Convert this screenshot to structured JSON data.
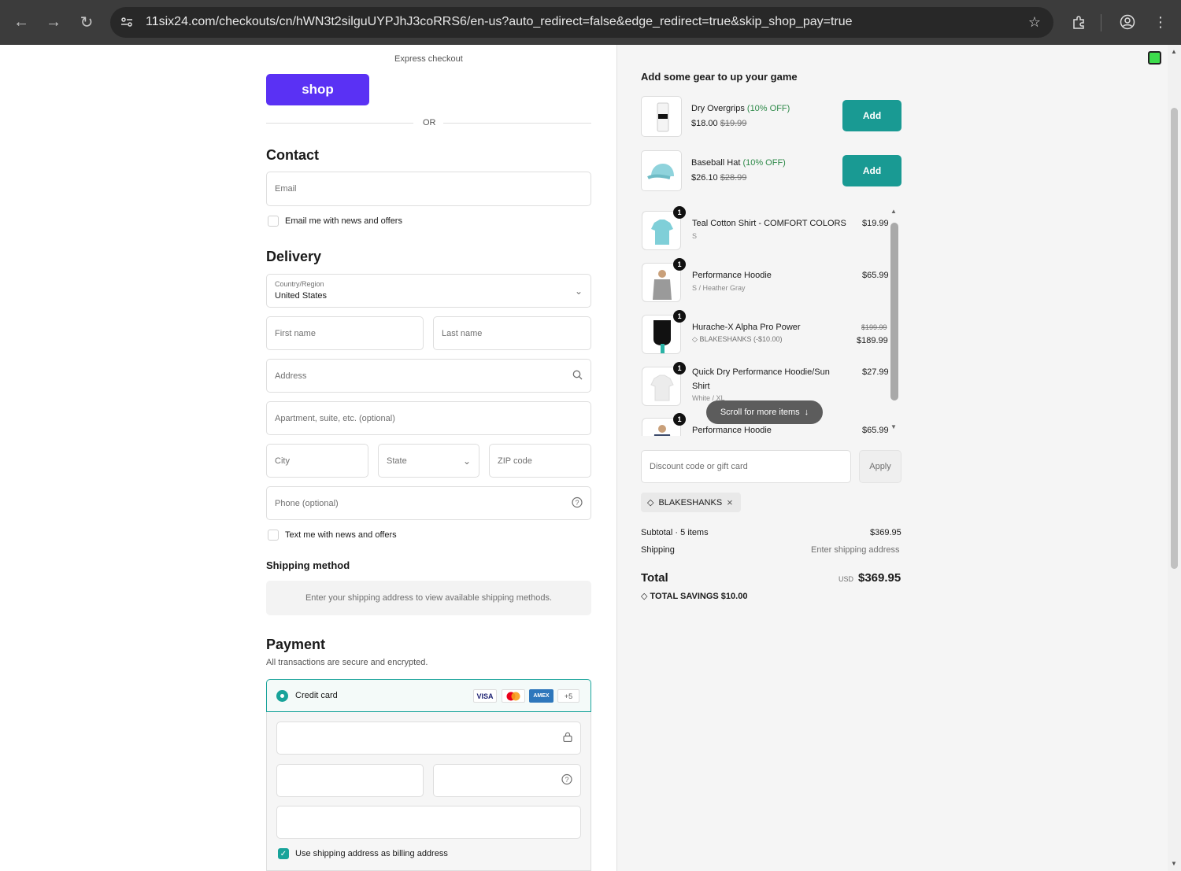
{
  "browser": {
    "url": "11six24.com/checkouts/cn/hWN3t2silguUYPJhJ3coRRS6/en-us?auto_redirect=false&edge_redirect=true&skip_shop_pay=true"
  },
  "express": {
    "label": "Express checkout",
    "shop_label": "shop",
    "or_label": "OR"
  },
  "contact": {
    "title": "Contact",
    "email_placeholder": "Email",
    "newsletter_label": "Email me with news and offers"
  },
  "delivery": {
    "title": "Delivery",
    "country_label": "Country/Region",
    "country_value": "United States",
    "first_name": "First name",
    "last_name": "Last name",
    "address": "Address",
    "apartment": "Apartment, suite, etc. (optional)",
    "city": "City",
    "state": "State",
    "zip": "ZIP code",
    "phone": "Phone (optional)",
    "sms_label": "Text me with news and offers"
  },
  "shipping_method": {
    "title": "Shipping method",
    "message": "Enter your shipping address to view available shipping methods."
  },
  "payment": {
    "title": "Payment",
    "subtitle": "All transactions are secure and encrypted.",
    "method_label": "Credit card",
    "cards": [
      "VISA",
      "MC",
      "AMEX",
      "+5"
    ],
    "billing_label": "Use shipping address as billing address"
  },
  "upsell": {
    "title": "Add some gear to up your game",
    "items": [
      {
        "name": "Dry Overgrips",
        "discount": "(10% OFF)",
        "price": "$18.00",
        "old_price": "$19.99",
        "button": "Add"
      },
      {
        "name": "Baseball Hat",
        "discount": "(10% OFF)",
        "price": "$26.10",
        "old_price": "$28.99",
        "button": "Add"
      }
    ]
  },
  "cart": {
    "items": [
      {
        "qty": "1",
        "name": "Teal Cotton Shirt - COMFORT COLORS",
        "variant": "S",
        "price": "$19.99"
      },
      {
        "qty": "1",
        "name": "Performance Hoodie",
        "variant": "S / Heather Gray",
        "price": "$65.99"
      },
      {
        "qty": "1",
        "name": "Hurache-X Alpha Pro Power",
        "discount": "BLAKESHANKS (-$10.00)",
        "old_price": "$199.99",
        "price": "$189.99"
      },
      {
        "qty": "1",
        "name": "Quick Dry Performance Hoodie/Sun",
        "name2": "Shirt",
        "variant": "White / XL",
        "price": "$27.99"
      },
      {
        "qty": "1",
        "name": "Performance Hoodie",
        "price": "$65.99"
      }
    ],
    "scroll_hint": "Scroll for more items"
  },
  "discount": {
    "placeholder": "Discount code or gift card",
    "apply": "Apply",
    "applied_code": "BLAKESHANKS"
  },
  "summary": {
    "subtotal_label": "Subtotal · 5 items",
    "subtotal_value": "$369.95",
    "shipping_label": "Shipping",
    "shipping_value": "Enter shipping address",
    "total_label": "Total",
    "currency": "USD",
    "total_value": "$369.95",
    "savings_label": "TOTAL SAVINGS",
    "savings_value": "$10.00"
  },
  "colors": {
    "shop_purple": "#5a31f4",
    "accent_teal": "#199a93",
    "discount_green": "#2f8a4a"
  }
}
